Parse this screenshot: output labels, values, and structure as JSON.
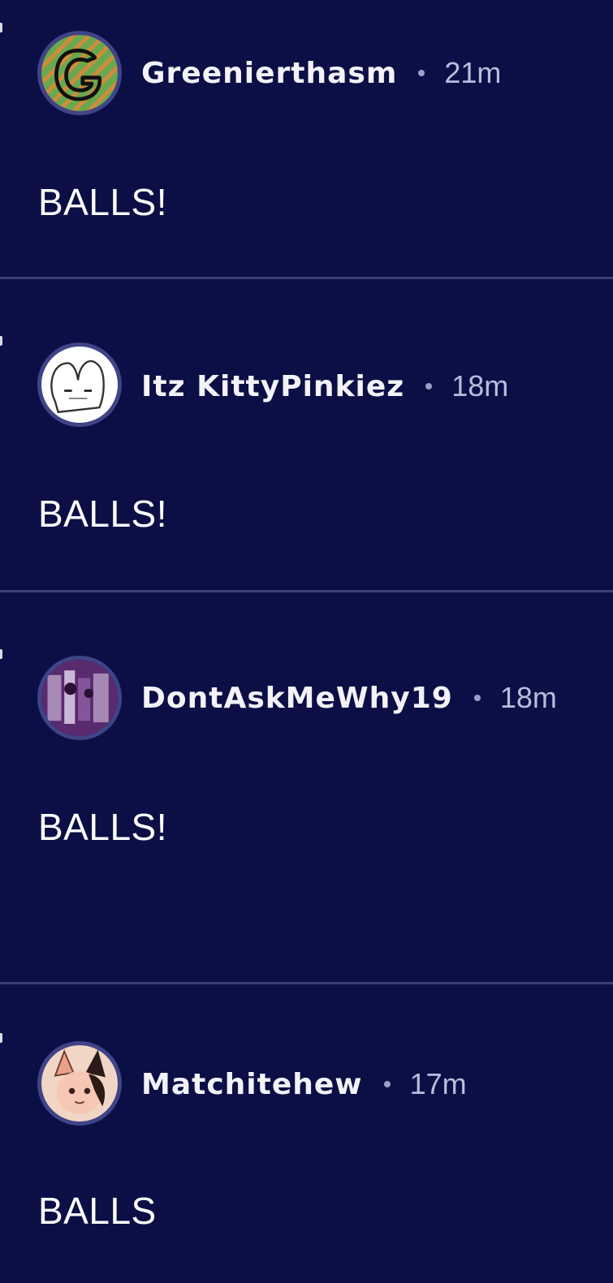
{
  "posts": [
    {
      "username": "Greenierthasm",
      "time": "21m",
      "text": "BALLS!",
      "avatar_icon": "letter-g-avatar-icon",
      "avatar_colors": [
        "#6aa84f",
        "#d48a3a"
      ]
    },
    {
      "username": "Itz KittyPinkiez",
      "time": "18m",
      "text": "BALLS!",
      "avatar_icon": "white-bunny-avatar-icon",
      "avatar_colors": [
        "#ffffff",
        "#222222"
      ]
    },
    {
      "username": "DontAskMeWhy19",
      "time": "18m",
      "text": "BALLS!",
      "avatar_icon": "purple-photo-avatar-icon",
      "avatar_colors": [
        "#5a2a6e",
        "#c9b3d6"
      ]
    },
    {
      "username": "Matchitehew",
      "time": "17m",
      "text": "BALLS",
      "avatar_icon": "fox-character-avatar-icon",
      "avatar_colors": [
        "#f1d6c6",
        "#e9a08c"
      ]
    }
  ],
  "colors": {
    "background": "#0b0f46",
    "divider": "#3a3f78",
    "avatar_ring": "#3f4488",
    "username": "#f2f2f7",
    "timestamp": "#b9bddb"
  }
}
